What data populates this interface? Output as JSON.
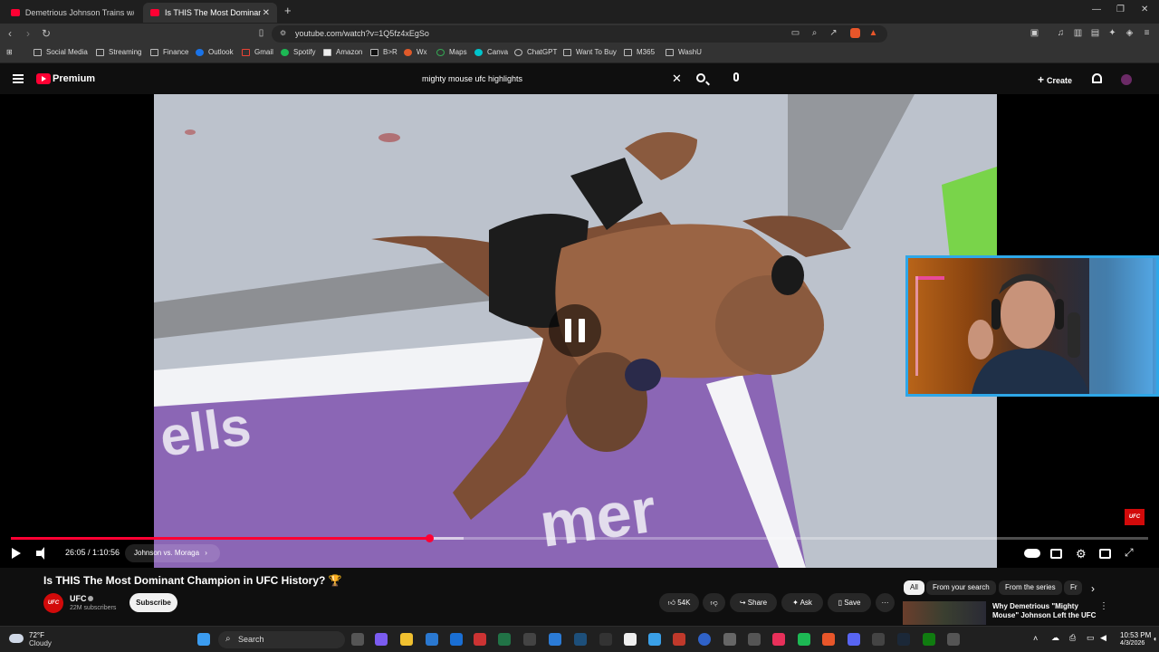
{
  "browser": {
    "tabs": [
      {
        "title": "Demetrious Johnson Trains w/ KHABI"
      },
      {
        "title": "Is THIS The Most Dominant C"
      }
    ],
    "url": "youtube.com/watch?v=1Q5fz4xEgSo",
    "bookmarks": [
      "Social Media",
      "Streaming",
      "Finance",
      "Outlook",
      "Gmail",
      "Spotify",
      "Amazon",
      "B>R",
      "Wx",
      "Maps",
      "Canva",
      "ChatGPT",
      "Want To Buy",
      "M365",
      "WashU"
    ]
  },
  "youtube": {
    "brand": "Premium",
    "search_query": "mighty mouse ufc highlights",
    "create_label": "Create"
  },
  "player": {
    "time": "26:05 / 1:10:56",
    "chapter": "Johnson vs. Moraga",
    "progress": 0.3675,
    "watermark": "UFC"
  },
  "video": {
    "title": "Is THIS The Most Dominant Champion in UFC History? 🏆",
    "channel": "UFC",
    "subscribers": "22M subscribers",
    "subscribe_label": "Subscribe",
    "likes": "54K",
    "share_label": "Share",
    "ask_label": "Ask",
    "save_label": "Save"
  },
  "sidebar": {
    "chips": [
      "All",
      "From your search",
      "From the series",
      "Fr"
    ],
    "recommendation_title": "Why Demetrious \"Mighty Mouse\" Johnson Left the UFC"
  },
  "taskbar": {
    "temperature": "72°F",
    "weather": "Cloudy",
    "search_label": "Search",
    "time": "10:53 PM",
    "date": "4/3/2026"
  },
  "colors": {
    "accent": "#ff0033",
    "ufc_red": "#d20a0a"
  }
}
